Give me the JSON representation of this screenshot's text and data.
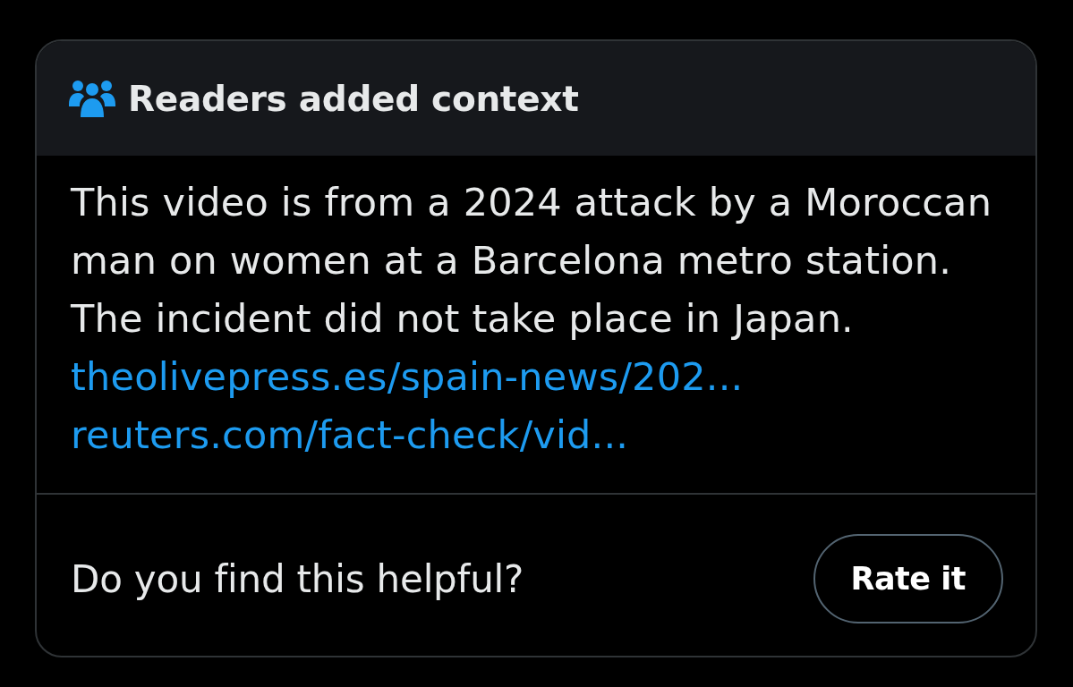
{
  "note": {
    "title": "Readers added context",
    "body": "This video is from a 2024 attack by a Moroccan man on women at a Barcelona metro station. The incident did not take place in Japan.",
    "links": [
      "theolivepress.es/spain-news/202...",
      "reuters.com/fact-check/vid..."
    ]
  },
  "footer": {
    "question": "Do you find this helpful?",
    "button": "Rate it"
  }
}
